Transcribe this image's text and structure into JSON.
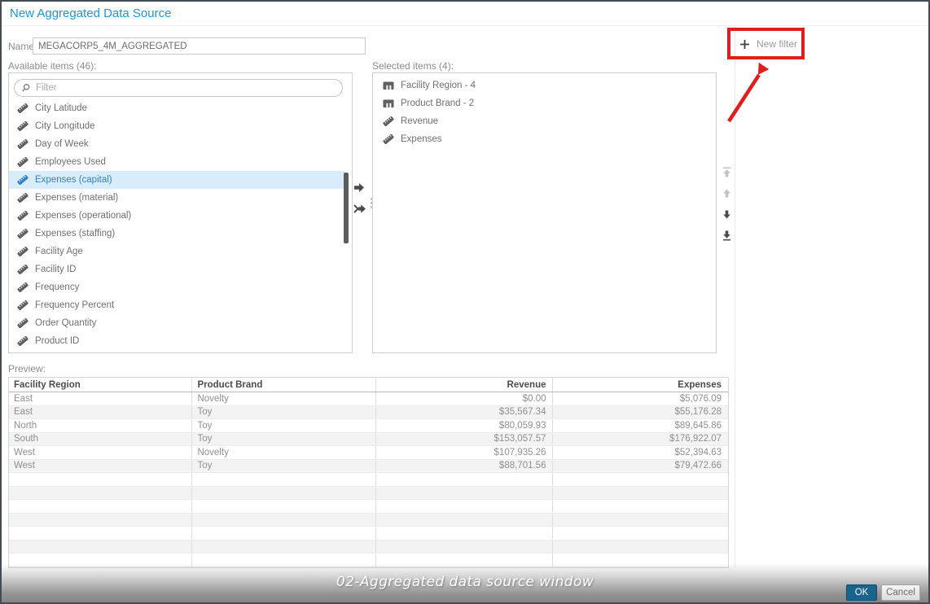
{
  "window": {
    "title": "New Aggregated Data Source",
    "caption": "02-Aggregated data source window"
  },
  "name_field": {
    "label": "Name:",
    "value": "MEGACORP5_4M_AGGREGATED"
  },
  "available": {
    "label": "Available items (46):",
    "filter_placeholder": "Filter",
    "items": [
      {
        "label": "City Latitude",
        "icon": "measure",
        "selected": false
      },
      {
        "label": "City Longitude",
        "icon": "measure",
        "selected": false
      },
      {
        "label": "Day of Week",
        "icon": "measure",
        "selected": false
      },
      {
        "label": "Employees Used",
        "icon": "measure",
        "selected": false
      },
      {
        "label": "Expenses (capital)",
        "icon": "measure",
        "selected": true
      },
      {
        "label": "Expenses (material)",
        "icon": "measure",
        "selected": false
      },
      {
        "label": "Expenses (operational)",
        "icon": "measure",
        "selected": false
      },
      {
        "label": "Expenses (staffing)",
        "icon": "measure",
        "selected": false
      },
      {
        "label": "Facility Age",
        "icon": "measure",
        "selected": false
      },
      {
        "label": "Facility ID",
        "icon": "measure",
        "selected": false
      },
      {
        "label": "Frequency",
        "icon": "measure",
        "selected": false
      },
      {
        "label": "Frequency Percent",
        "icon": "measure",
        "selected": false
      },
      {
        "label": "Order Quantity",
        "icon": "measure",
        "selected": false
      },
      {
        "label": "Product ID",
        "icon": "measure",
        "selected": false
      }
    ]
  },
  "selected_items": {
    "label": "Selected items (4):",
    "items": [
      {
        "label": "Facility Region - 4",
        "icon": "category"
      },
      {
        "label": "Product Brand - 2",
        "icon": "category"
      },
      {
        "label": "Revenue",
        "icon": "measure"
      },
      {
        "label": "Expenses",
        "icon": "measure"
      }
    ]
  },
  "transfer_buttons": [
    {
      "name": "move-right",
      "icon": "arrow-right",
      "enabled": true
    },
    {
      "name": "move-all-right",
      "icon": "double-arrow-right",
      "enabled": true
    }
  ],
  "reorder_buttons": [
    {
      "name": "move-to-top",
      "icon": "arrow-to-top",
      "enabled": false
    },
    {
      "name": "move-up",
      "icon": "arrow-up",
      "enabled": false
    },
    {
      "name": "move-down",
      "icon": "arrow-down",
      "enabled": true
    },
    {
      "name": "move-to-bottom",
      "icon": "arrow-to-bottom",
      "enabled": true
    }
  ],
  "new_filter": {
    "label": "New filter",
    "icon": "plus"
  },
  "preview": {
    "label": "Preview:",
    "columns": [
      {
        "label": "Facility Region",
        "align": "left"
      },
      {
        "label": "Product Brand",
        "align": "left"
      },
      {
        "label": "Revenue",
        "align": "right"
      },
      {
        "label": "Expenses",
        "align": "right"
      }
    ],
    "rows": [
      [
        "East",
        "Novelty",
        "$0.00",
        "$5,076.09"
      ],
      [
        "East",
        "Toy",
        "$35,567.34",
        "$55,176.28"
      ],
      [
        "North",
        "Toy",
        "$80,059.93",
        "$89,645.86"
      ],
      [
        "South",
        "Toy",
        "$153,057.57",
        "$176,922.07"
      ],
      [
        "West",
        "Novelty",
        "$107,935.26",
        "$52,394.63"
      ],
      [
        "West",
        "Toy",
        "$88,701.56",
        "$79,472.66"
      ]
    ],
    "empty_row_count": 7
  },
  "footer_buttons": {
    "ok": "OK",
    "cancel": "Cancel"
  },
  "colors": {
    "title_accent": "#2196d5",
    "selection_bg": "#d9ecf9",
    "selection_text": "#2d83c5",
    "annotation_red": "#e01e1e",
    "ok_button_bg": "#19638d",
    "caption_text": "#ffffff"
  }
}
